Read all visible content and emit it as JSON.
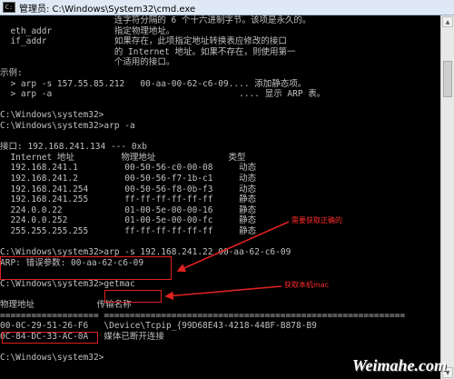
{
  "window": {
    "title": "管理员: C:\\Windows\\System32\\cmd.exe"
  },
  "console_lines": [
    "                      连字符分隔的 6 个十六进制字节。该项是永久的。",
    "  eth_addr            指定物理地址。",
    "  if_addr             如果存在，此项指定地址转换表应修改的接口",
    "                      的 Internet 地址。如果不存在，则使用第一",
    "                      个适用的接口。",
    "示例:",
    "  > arp -s 157.55.85.212   00-aa-00-62-c6-09.... 添加静态项。",
    "  > arp -a                                    .... 显示 ARP 表。",
    "",
    "C:\\Windows\\system32>",
    "C:\\Windows\\system32>arp -a",
    "",
    "接口: 192.168.241.134 --- 0xb",
    "  Internet 地址         物理地址              类型",
    "  192.168.241.1         00-50-56-c0-00-08     动态",
    "  192.168.241.2         00-50-56-f7-1b-c1     动态",
    "  192.168.241.254       00-50-56-f8-0b-f3     动态",
    "  192.168.241.255       ff-ff-ff-ff-ff-ff     静态",
    "  224.0.0.22            01-00-5e-00-00-16     静态",
    "  224.0.0.252           01-00-5e-00-00-fc     静态",
    "  255.255.255.255       ff-ff-ff-ff-ff-ff     静态",
    "",
    "C:\\Windows\\system32>arp -s 192.168.241.22 00-aa-62-c6-09",
    "ARP: 错误参数: 00-aa-62-c6-09",
    "",
    "C:\\Windows\\system32>getmac",
    "",
    "物理地址            传输名称",
    "=================== ==========================================================",
    "00-0C-29-51-26-F6   \\Device\\Tcpip_{99D68E43-4218-44BF-B878-B9",
    "0C-84-DC-33-AC-0A   媒体已断开连接",
    "",
    "C:\\Windows\\system32>"
  ],
  "annotations": {
    "need_correct": "需要获取正确的",
    "get_mac": "获取本机mac"
  },
  "watermark": "Weimahe.com",
  "colors": {
    "annotation": "#e02020",
    "console_text": "#c0c0c0",
    "background": "#000000"
  }
}
